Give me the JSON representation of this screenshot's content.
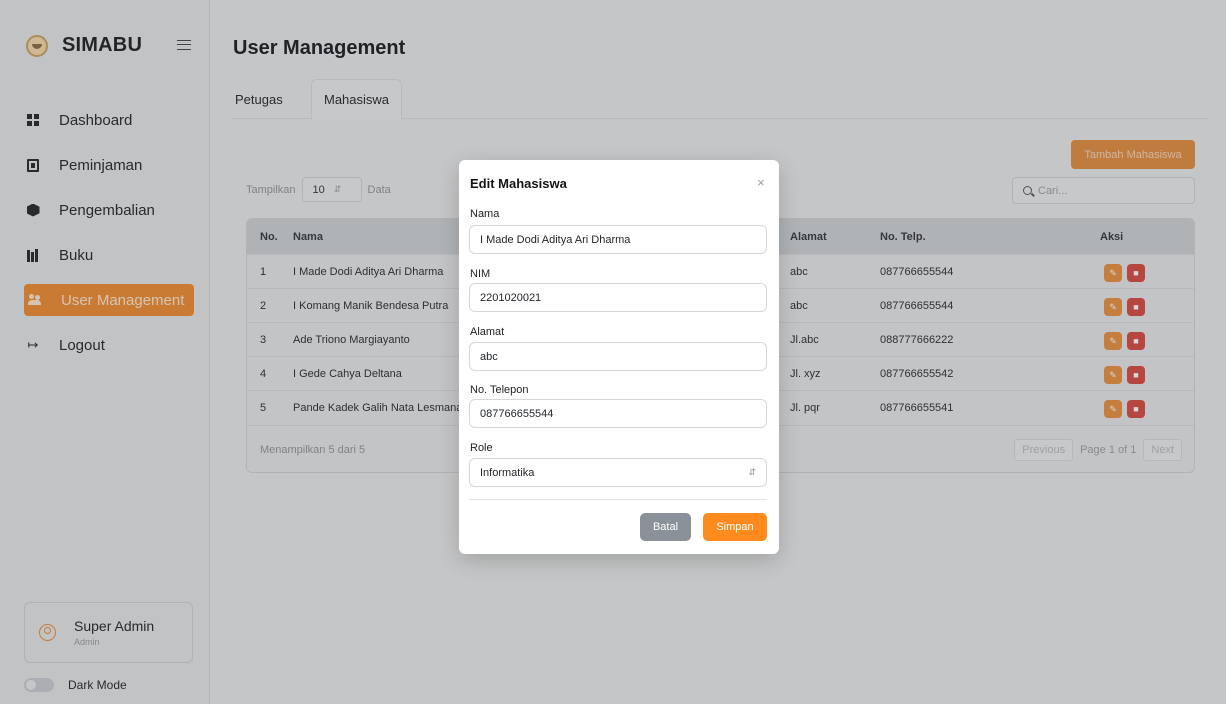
{
  "brand": {
    "name": "SIMABU"
  },
  "sidebar": {
    "items": [
      {
        "label": "Dashboard"
      },
      {
        "label": "Peminjaman"
      },
      {
        "label": "Pengembalian"
      },
      {
        "label": "Buku"
      },
      {
        "label": "User Management"
      },
      {
        "label": "Logout"
      }
    ],
    "profile": {
      "name": "Super Admin",
      "role": "Admin"
    },
    "dark_mode_label": "Dark Mode"
  },
  "main": {
    "title": "User Management",
    "tabs": [
      {
        "label": "Petugas"
      },
      {
        "label": "Mahasiswa"
      }
    ],
    "add_button": "Tambah Mahasiswa",
    "show": {
      "prefix": "Tampilkan",
      "value": "10",
      "suffix": "Data"
    },
    "search_placeholder": "Cari...",
    "table": {
      "headers": {
        "no": "No.",
        "nama": "Nama",
        "alamat": "Alamat",
        "telp": "No. Telp.",
        "aksi": "Aksi"
      },
      "rows": [
        {
          "no": "1",
          "nama": "I Made Dodi Aditya Ari Dharma",
          "alamat": "abc",
          "telp": "087766655544"
        },
        {
          "no": "2",
          "nama": "I Komang Manik Bendesa Putra",
          "alamat": "abc",
          "telp": "087766655544"
        },
        {
          "no": "3",
          "nama": "Ade Triono Margiayanto",
          "alamat": "Jl.abc",
          "telp": "088777666222"
        },
        {
          "no": "4",
          "nama": "I Gede Cahya Deltana",
          "alamat": "Jl. xyz",
          "telp": "087766655542"
        },
        {
          "no": "5",
          "nama": "Pande Kadek Galih Nata Lesmana",
          "alamat": "Jl. pqr",
          "telp": "087766655541"
        }
      ],
      "footer_info": "Menampilkan 5 dari 5",
      "pager": {
        "prev": "Previous",
        "info": "Page 1 of 1",
        "next": "Next"
      }
    }
  },
  "modal": {
    "title": "Edit Mahasiswa",
    "close": "×",
    "fields": {
      "nama": {
        "label": "Nama",
        "value": "I Made Dodi Aditya Ari Dharma"
      },
      "nim": {
        "label": "NIM",
        "value": "2201020021"
      },
      "alamat": {
        "label": "Alamat",
        "value": "abc"
      },
      "telepon": {
        "label": "No. Telepon",
        "value": "087766655544"
      },
      "role": {
        "label": "Role",
        "value": "Informatika"
      }
    },
    "cancel": "Batal",
    "save": "Simpan"
  },
  "colors": {
    "accent": "#f08a2c",
    "danger": "#d9463d",
    "cancel": "#8a9199"
  }
}
